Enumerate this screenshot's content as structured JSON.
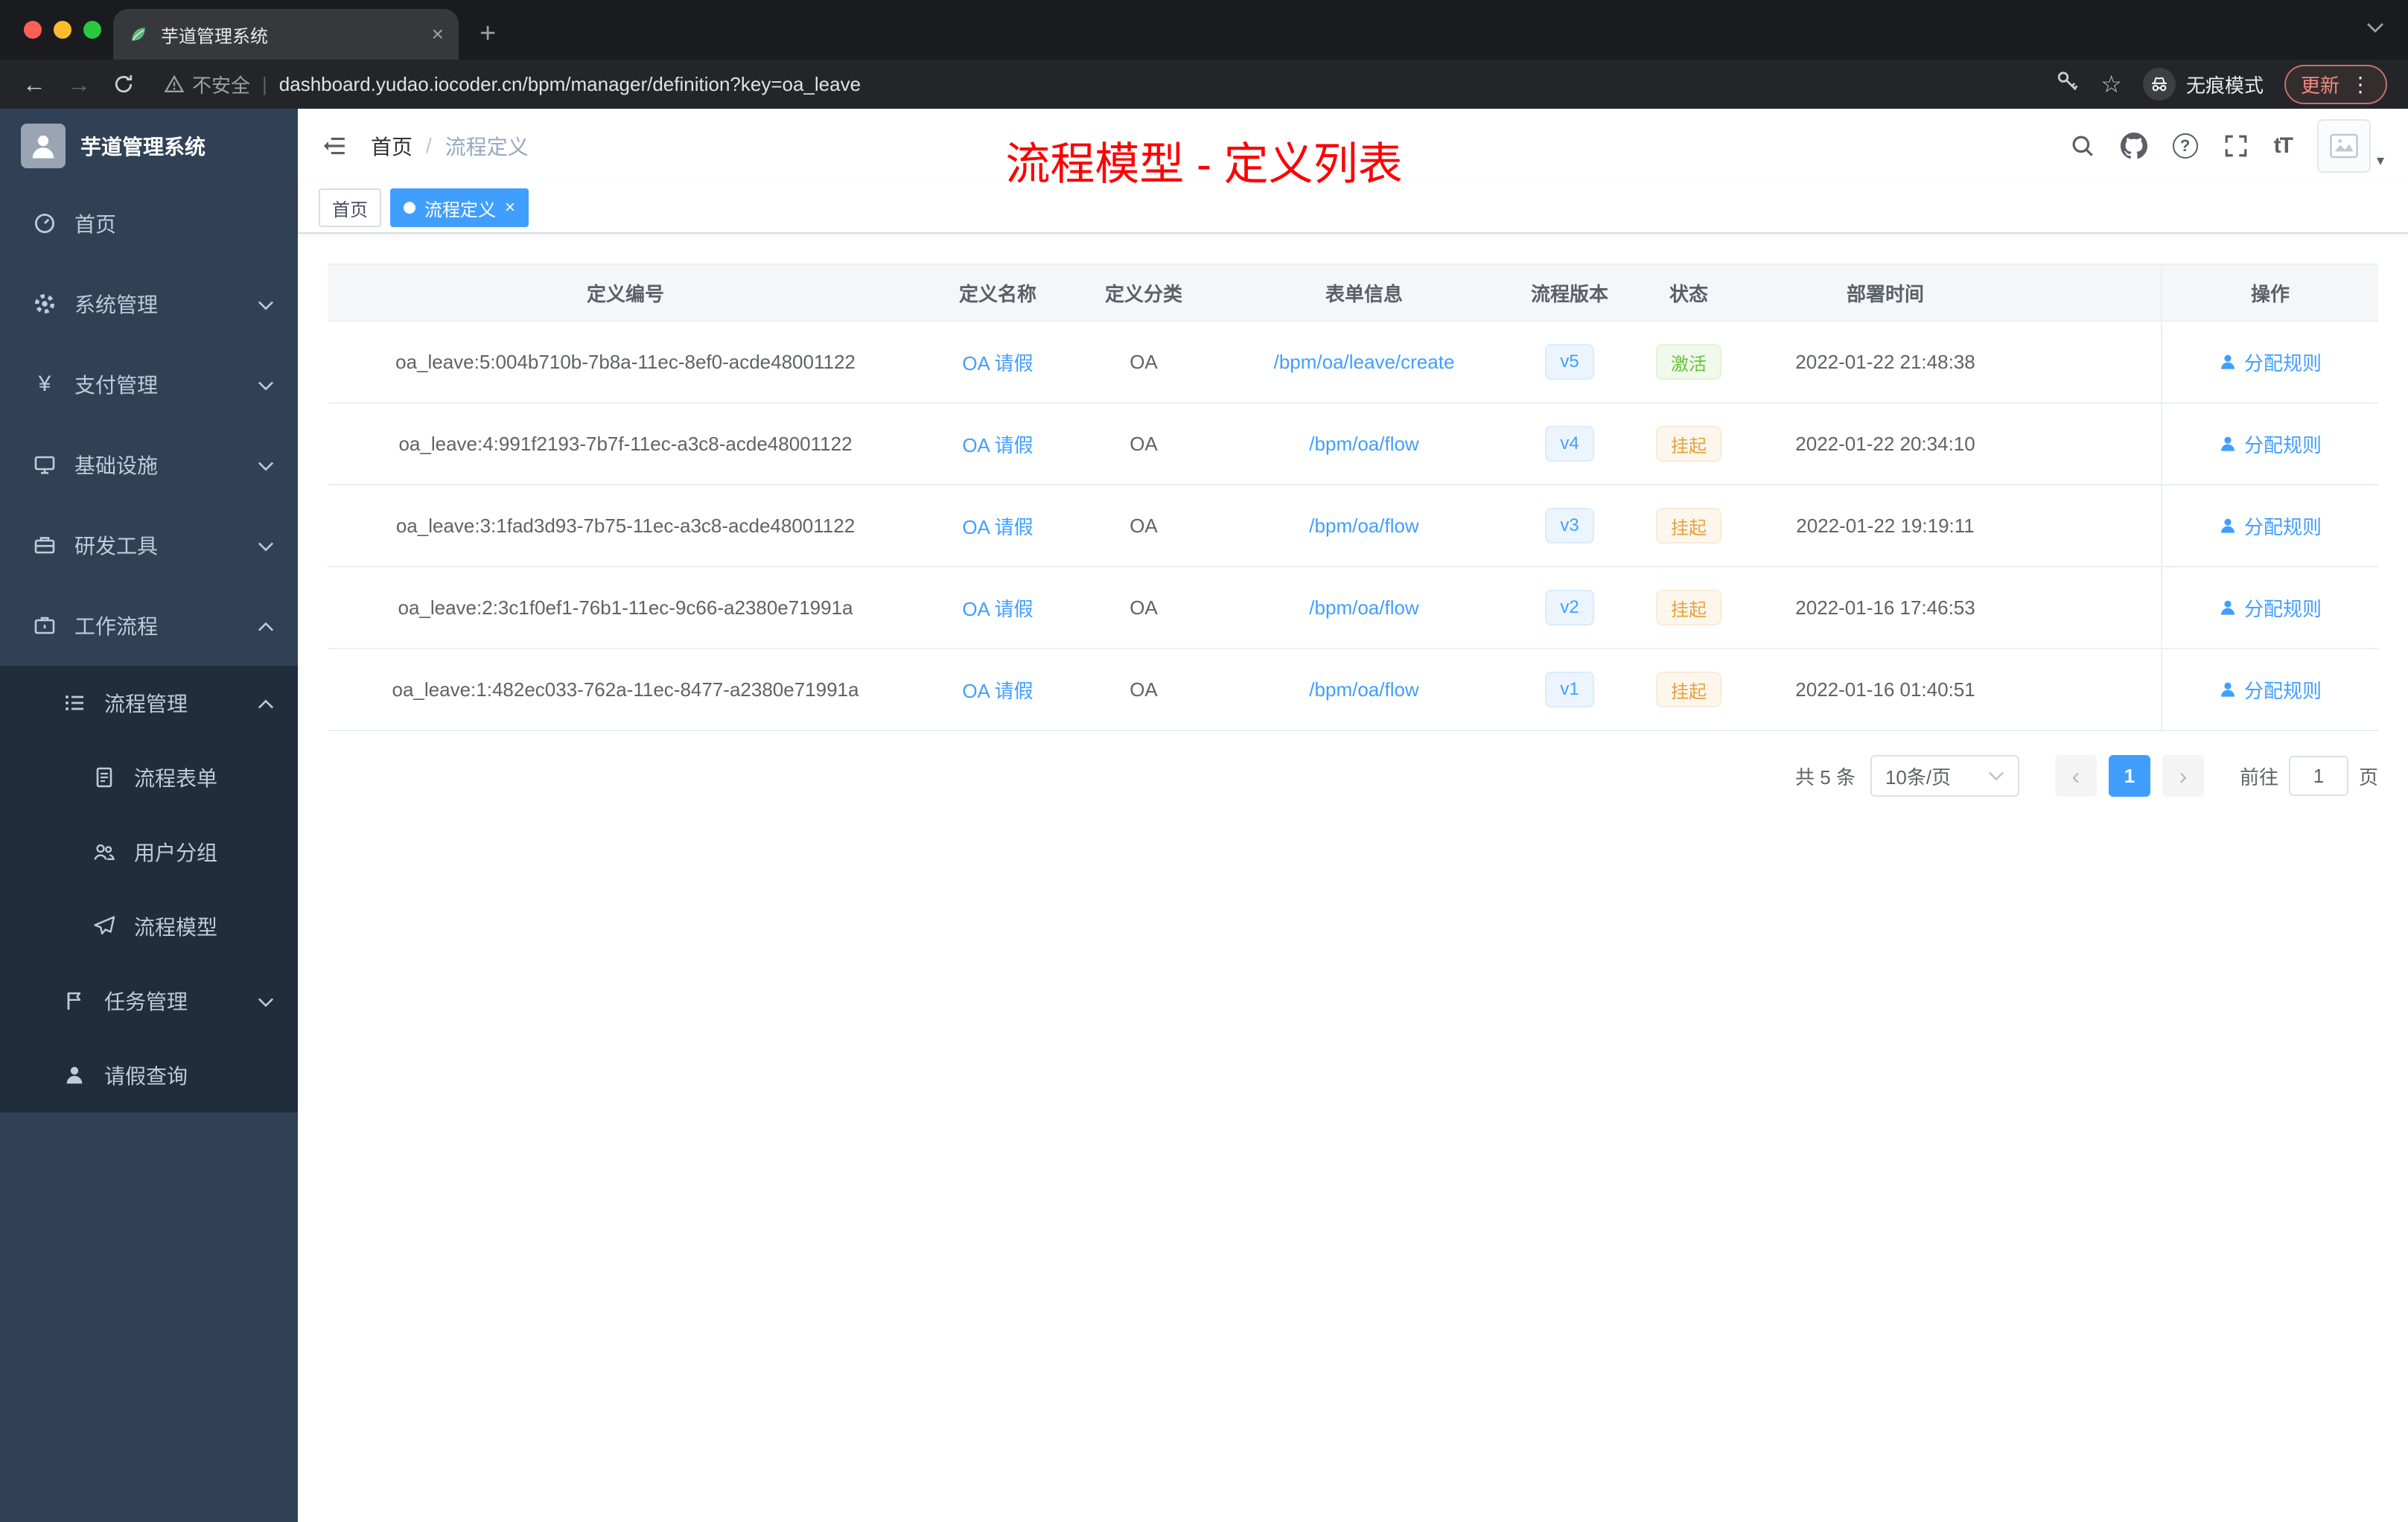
{
  "icons": {
    "plus": "+",
    "close": "×",
    "back": "←",
    "forward": "→",
    "star": "☆",
    "more": "⋮",
    "caret_down": "▾",
    "divider": "|",
    "slash": "/",
    "yen": "¥",
    "question": "?",
    "font_size": "tT",
    "prev": "‹",
    "next": "›"
  },
  "browser": {
    "tab_title": "芋道管理系统",
    "security_label": "不安全",
    "url": "dashboard.yudao.iocoder.cn/bpm/manager/definition?key=oa_leave",
    "incognito_label": "无痕模式",
    "update_label": "更新"
  },
  "sidebar": {
    "logo_title": "芋道管理系统",
    "menu": [
      {
        "label": "首页"
      },
      {
        "label": "系统管理"
      },
      {
        "label": "支付管理"
      },
      {
        "label": "基础设施"
      },
      {
        "label": "研发工具"
      },
      {
        "label": "工作流程",
        "children": [
          {
            "label": "流程管理",
            "children": [
              {
                "label": "流程表单"
              },
              {
                "label": "用户分组"
              },
              {
                "label": "流程模型"
              }
            ]
          },
          {
            "label": "任务管理"
          },
          {
            "label": "请假查询"
          }
        ]
      }
    ]
  },
  "topbar": {
    "breadcrumb_home": "首页",
    "breadcrumb_current": "流程定义",
    "annotation": "流程模型 - 定义列表"
  },
  "tags": {
    "home": "首页",
    "active": "流程定义"
  },
  "table": {
    "headers": [
      "定义编号",
      "定义名称",
      "定义分类",
      "表单信息",
      "流程版本",
      "状态",
      "部署时间",
      "操作"
    ],
    "rows": [
      {
        "id": "oa_leave:5:004b710b-7b8a-11ec-8ef0-acde48001122",
        "name": "OA 请假",
        "category": "OA",
        "form": "/bpm/oa/leave/create",
        "version": "v5",
        "status": "激活",
        "time": "2022-01-22 21:48:38",
        "action": "分配规则"
      },
      {
        "id": "oa_leave:4:991f2193-7b7f-11ec-a3c8-acde48001122",
        "name": "OA 请假",
        "category": "OA",
        "form": "/bpm/oa/flow",
        "version": "v4",
        "status": "挂起",
        "time": "2022-01-22 20:34:10",
        "action": "分配规则"
      },
      {
        "id": "oa_leave:3:1fad3d93-7b75-11ec-a3c8-acde48001122",
        "name": "OA 请假",
        "category": "OA",
        "form": "/bpm/oa/flow",
        "version": "v3",
        "status": "挂起",
        "time": "2022-01-22 19:19:11",
        "action": "分配规则"
      },
      {
        "id": "oa_leave:2:3c1f0ef1-76b1-11ec-9c66-a2380e71991a",
        "name": "OA 请假",
        "category": "OA",
        "form": "/bpm/oa/flow",
        "version": "v2",
        "status": "挂起",
        "time": "2022-01-16 17:46:53",
        "action": "分配规则"
      },
      {
        "id": "oa_leave:1:482ec033-762a-11ec-8477-a2380e71991a",
        "name": "OA 请假",
        "category": "OA",
        "form": "/bpm/oa/flow",
        "version": "v1",
        "status": "挂起",
        "time": "2022-01-16 01:40:51",
        "action": "分配规则"
      }
    ]
  },
  "pagination": {
    "total": "共 5 条",
    "page_size": "10条/页",
    "current_page": "1",
    "goto_label": "前往",
    "goto_value": "1",
    "page_label": "页"
  }
}
